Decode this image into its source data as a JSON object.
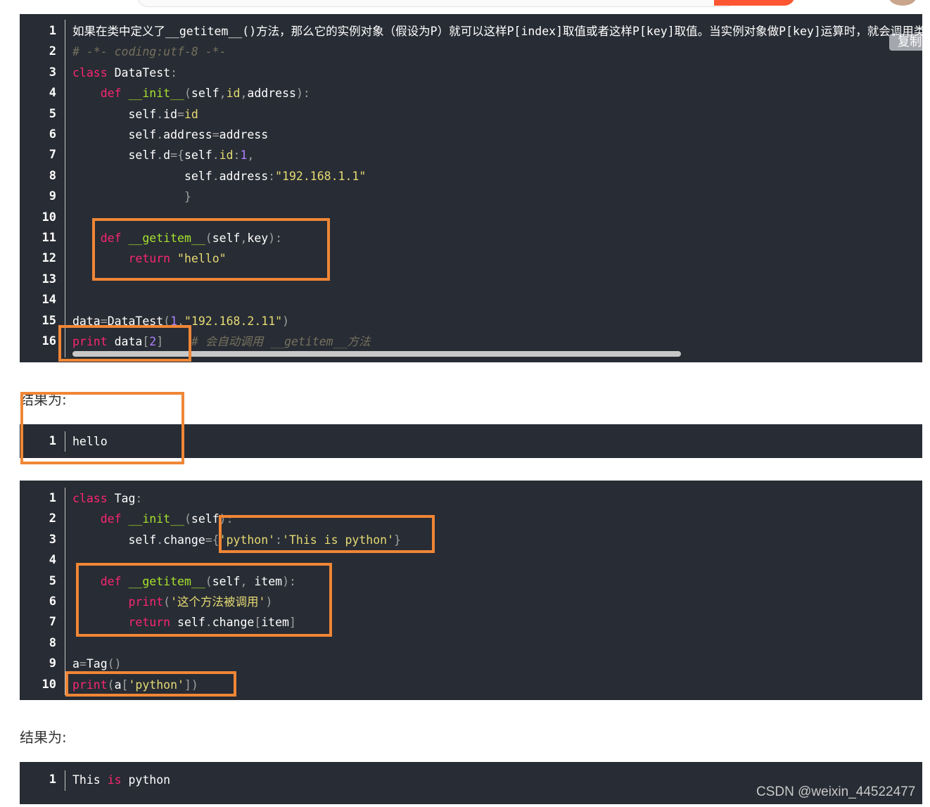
{
  "copy_label": "复制",
  "block1": {
    "lines": [
      {
        "n": "1",
        "tokens": [
          [
            "plain",
            "如果在类中定义了__getitem__()方法，那么它的实例对象（假设为P）就可以这样P[index]取值或者这样P[key]取值。当实例对象做P[key]运算时，就会调用类中的"
          ]
        ]
      },
      {
        "n": "2",
        "tokens": [
          [
            "cm",
            "# -*- coding:utf-8 -*-"
          ]
        ]
      },
      {
        "n": "3",
        "tokens": [
          [
            "kw",
            "class"
          ],
          [
            "plain",
            " DataTest"
          ],
          [
            "pun",
            ":"
          ]
        ]
      },
      {
        "n": "4",
        "tokens": [
          [
            "plain",
            "    "
          ],
          [
            "kw",
            "def"
          ],
          [
            "plain",
            " "
          ],
          [
            "fn",
            "__init__"
          ],
          [
            "pun",
            "("
          ],
          [
            "plain",
            "self"
          ],
          [
            "pun",
            ","
          ],
          [
            "str",
            "id"
          ],
          [
            "pun",
            ","
          ],
          [
            "plain",
            "address"
          ],
          [
            "pun",
            "):"
          ]
        ]
      },
      {
        "n": "5",
        "tokens": [
          [
            "plain",
            "        self"
          ],
          [
            "pun",
            "."
          ],
          [
            "plain",
            "id"
          ],
          [
            "pun",
            "="
          ],
          [
            "str",
            "id"
          ]
        ]
      },
      {
        "n": "6",
        "tokens": [
          [
            "plain",
            "        self"
          ],
          [
            "pun",
            "."
          ],
          [
            "plain",
            "address"
          ],
          [
            "pun",
            "="
          ],
          [
            "plain",
            "address"
          ]
        ]
      },
      {
        "n": "7",
        "tokens": [
          [
            "plain",
            "        self"
          ],
          [
            "pun",
            "."
          ],
          [
            "plain",
            "d"
          ],
          [
            "pun",
            "={"
          ],
          [
            "plain",
            "self"
          ],
          [
            "pun",
            "."
          ],
          [
            "str",
            "id"
          ],
          [
            "pun",
            ":"
          ],
          [
            "num",
            "1"
          ],
          [
            "pun",
            ","
          ]
        ]
      },
      {
        "n": "8",
        "tokens": [
          [
            "plain",
            "                self"
          ],
          [
            "pun",
            "."
          ],
          [
            "plain",
            "address"
          ],
          [
            "pun",
            ":"
          ],
          [
            "str",
            "\"192.168.1.1\""
          ]
        ]
      },
      {
        "n": "9",
        "tokens": [
          [
            "pun",
            "                }"
          ]
        ]
      },
      {
        "n": "10",
        "tokens": []
      },
      {
        "n": "11",
        "tokens": [
          [
            "plain",
            "    "
          ],
          [
            "kw",
            "def"
          ],
          [
            "plain",
            " "
          ],
          [
            "fn",
            "__getitem__"
          ],
          [
            "pun",
            "("
          ],
          [
            "plain",
            "self"
          ],
          [
            "pun",
            ","
          ],
          [
            "plain",
            "key"
          ],
          [
            "pun",
            "):"
          ]
        ]
      },
      {
        "n": "12",
        "tokens": [
          [
            "plain",
            "        "
          ],
          [
            "kw",
            "return"
          ],
          [
            "plain",
            " "
          ],
          [
            "str",
            "\"hello\""
          ]
        ]
      },
      {
        "n": "13",
        "tokens": []
      },
      {
        "n": "14",
        "tokens": []
      },
      {
        "n": "15",
        "tokens": [
          [
            "plain",
            "data"
          ],
          [
            "pun",
            "="
          ],
          [
            "plain",
            "DataTest"
          ],
          [
            "pun",
            "("
          ],
          [
            "num",
            "1"
          ],
          [
            "pun",
            ","
          ],
          [
            "str",
            "\"192.168.2.11\""
          ],
          [
            "pun",
            ")"
          ]
        ]
      },
      {
        "n": "16",
        "tokens": [
          [
            "kw",
            "print"
          ],
          [
            "plain",
            " data"
          ],
          [
            "pun",
            "["
          ],
          [
            "num",
            "2"
          ],
          [
            "pun",
            "]"
          ],
          [
            "plain",
            "    "
          ],
          [
            "cm",
            "# 会自动调用 __getitem__方法"
          ]
        ]
      }
    ]
  },
  "result1_label": "结果为:",
  "block2": {
    "lines": [
      {
        "n": "1",
        "tokens": [
          [
            "plain",
            "hello"
          ]
        ]
      }
    ]
  },
  "block3": {
    "lines": [
      {
        "n": "1",
        "tokens": [
          [
            "kw",
            "class"
          ],
          [
            "plain",
            " Tag"
          ],
          [
            "pun",
            ":"
          ]
        ]
      },
      {
        "n": "2",
        "tokens": [
          [
            "plain",
            "    "
          ],
          [
            "kw",
            "def"
          ],
          [
            "plain",
            " "
          ],
          [
            "fn",
            "__init__"
          ],
          [
            "pun",
            "("
          ],
          [
            "plain",
            "self"
          ],
          [
            "pun",
            "):"
          ]
        ]
      },
      {
        "n": "3",
        "tokens": [
          [
            "plain",
            "        self"
          ],
          [
            "pun",
            "."
          ],
          [
            "plain",
            "change"
          ],
          [
            "pun",
            "="
          ],
          [
            "pun",
            "{"
          ],
          [
            "str",
            "'python'"
          ],
          [
            "pun",
            ":"
          ],
          [
            "str",
            "'This is python'"
          ],
          [
            "pun",
            "}"
          ]
        ]
      },
      {
        "n": "4",
        "tokens": []
      },
      {
        "n": "5",
        "tokens": [
          [
            "plain",
            "    "
          ],
          [
            "kw",
            "def"
          ],
          [
            "plain",
            " "
          ],
          [
            "fn",
            "__getitem__"
          ],
          [
            "pun",
            "("
          ],
          [
            "plain",
            "self"
          ],
          [
            "pun",
            ","
          ],
          [
            "plain",
            " item"
          ],
          [
            "pun",
            "):"
          ]
        ]
      },
      {
        "n": "6",
        "tokens": [
          [
            "plain",
            "        "
          ],
          [
            "kw",
            "print"
          ],
          [
            "pun",
            "("
          ],
          [
            "str",
            "'这个方法被调用'"
          ],
          [
            "pun",
            ")"
          ]
        ]
      },
      {
        "n": "7",
        "tokens": [
          [
            "plain",
            "        "
          ],
          [
            "kw",
            "return"
          ],
          [
            "plain",
            " self"
          ],
          [
            "pun",
            "."
          ],
          [
            "plain",
            "change"
          ],
          [
            "pun",
            "["
          ],
          [
            "plain",
            "item"
          ],
          [
            "pun",
            "]"
          ]
        ]
      },
      {
        "n": "8",
        "tokens": []
      },
      {
        "n": "9",
        "tokens": [
          [
            "plain",
            "a"
          ],
          [
            "pun",
            "="
          ],
          [
            "plain",
            "Tag"
          ],
          [
            "pun",
            "()"
          ]
        ]
      },
      {
        "n": "10",
        "tokens": [
          [
            "kw",
            "print"
          ],
          [
            "pun",
            "("
          ],
          [
            "plain",
            "a"
          ],
          [
            "pun",
            "["
          ],
          [
            "str",
            "'python'"
          ],
          [
            "pun",
            "])"
          ]
        ]
      }
    ]
  },
  "result2_label": "结果为:",
  "block4": {
    "lines": [
      {
        "n": "1",
        "tokens": [
          [
            "plain",
            "This "
          ],
          [
            "kw",
            "is"
          ],
          [
            "plain",
            " python"
          ]
        ]
      }
    ]
  },
  "watermark": "CSDN @weixin_44522477"
}
